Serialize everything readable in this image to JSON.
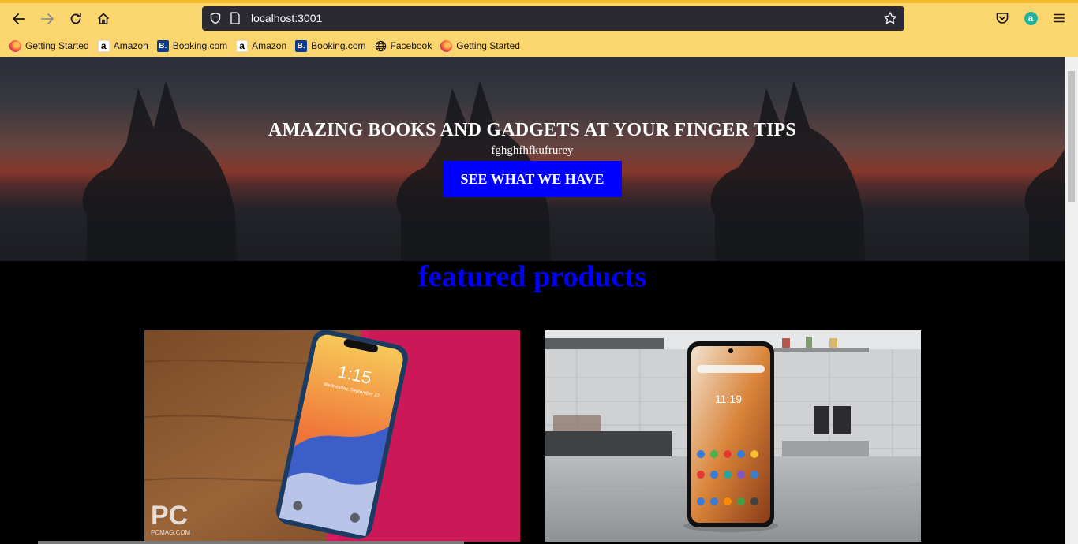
{
  "browser": {
    "url": "localhost:3001",
    "bookmarks": [
      {
        "label": "Getting Started",
        "icon": "firefox-icon"
      },
      {
        "label": "Amazon",
        "icon": "amazon-icon"
      },
      {
        "label": "Booking.com",
        "icon": "booking-icon"
      },
      {
        "label": "Amazon",
        "icon": "amazon-icon"
      },
      {
        "label": "Booking.com",
        "icon": "booking-icon"
      },
      {
        "label": "Facebook",
        "icon": "globe-icon"
      },
      {
        "label": "Getting Started",
        "icon": "firefox-icon"
      }
    ],
    "colors": {
      "toolbar": "#fbd56e",
      "urlbar": "#2b2a33"
    }
  },
  "hero": {
    "title": "AMAZING BOOKS AND GADGETS AT YOUR FINGER TIPS",
    "subtitle": "fghghfhfkufrurey",
    "cta_label": "SEE WHAT WE HAVE",
    "cta_color": "#0000ff"
  },
  "featured": {
    "heading": "featured products",
    "heading_color": "#0000ff",
    "products": [
      {
        "image": "iphone-on-wood-photo",
        "watermark": "PC PCMAG.COM"
      },
      {
        "image": "android-phone-kitchen-photo"
      }
    ]
  },
  "phone1": {
    "time": "1:15",
    "date": "Wednesday, September 22"
  },
  "phone2": {
    "time": "11:19"
  }
}
